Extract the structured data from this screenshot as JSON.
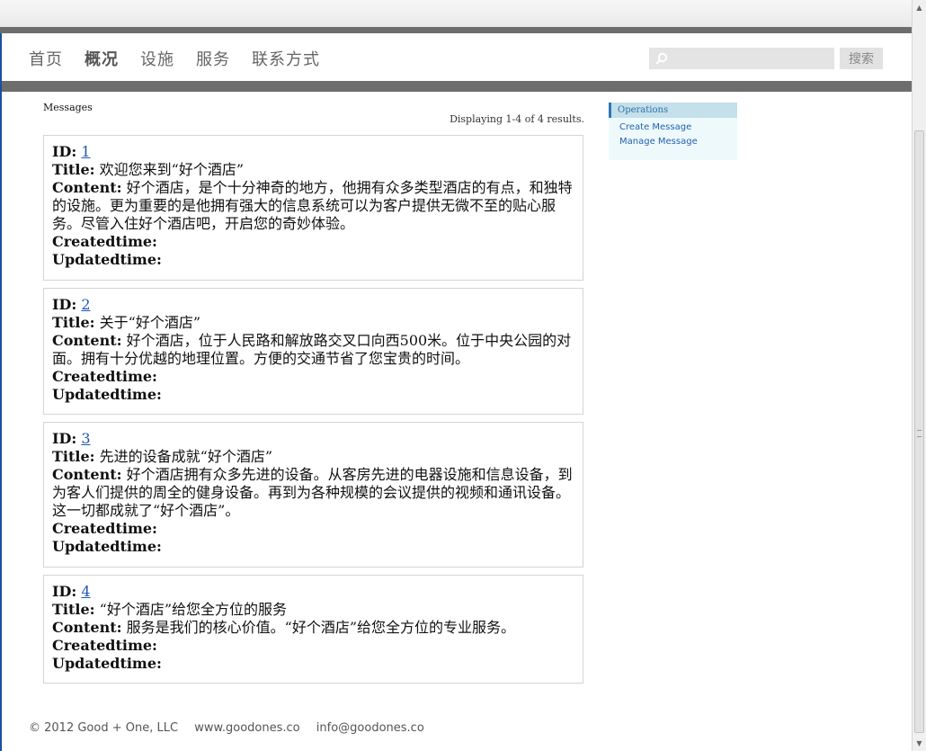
{
  "nav": {
    "items": [
      "首页",
      "概况",
      "设施",
      "服务",
      "联系方式"
    ],
    "active_index": 1
  },
  "search": {
    "placeholder": "",
    "button_label": "搜索"
  },
  "breadcrumb": "Messages",
  "summary": "Displaying 1-4 of 4 results.",
  "labels": {
    "id": "ID:",
    "title": "Title:",
    "content": "Content:",
    "created": "Createdtime:",
    "updated": "Updatedtime:"
  },
  "messages": [
    {
      "id": "1",
      "title": "欢迎您来到“好个酒店”",
      "content": "好个酒店，是个十分神奇的地方，他拥有众多类型酒店的有点，和独特的设施。更为重要的是他拥有强大的信息系统可以为客户提供无微不至的贴心服务。尽管入住好个酒店吧，开启您的奇妙体验。"
    },
    {
      "id": "2",
      "title": "关于“好个酒店”",
      "content": "好个酒店，位于人民路和解放路交叉口向西500米。位于中央公园的对面。拥有十分优越的地理位置。方便的交通节省了您宝贵的时间。"
    },
    {
      "id": "3",
      "title": "先进的设备成就“好个酒店”",
      "content": "好个酒店拥有众多先进的设备。从客房先进的电器设施和信息设备，到为客人们提供的周全的健身设备。再到为各种规模的会议提供的视频和通讯设备。这一切都成就了“好个酒店”。"
    },
    {
      "id": "4",
      "title": "“好个酒店”给您全方位的服务",
      "content": "服务是我们的核心价值。“好个酒店”给您全方位的专业服务。"
    }
  ],
  "operations": {
    "title": "Operations",
    "links": [
      "Create Message",
      "Manage Message"
    ]
  },
  "footer": {
    "copyright": "© 2012 Good + One, LLC",
    "site": "www.goodones.co",
    "email": "info@goodones.co"
  },
  "colors": {
    "nav_bar": "#6d6d6d",
    "link": "#1f55b3",
    "ops_header": "#c3e0eb",
    "ops_bg": "#eef9fb"
  }
}
